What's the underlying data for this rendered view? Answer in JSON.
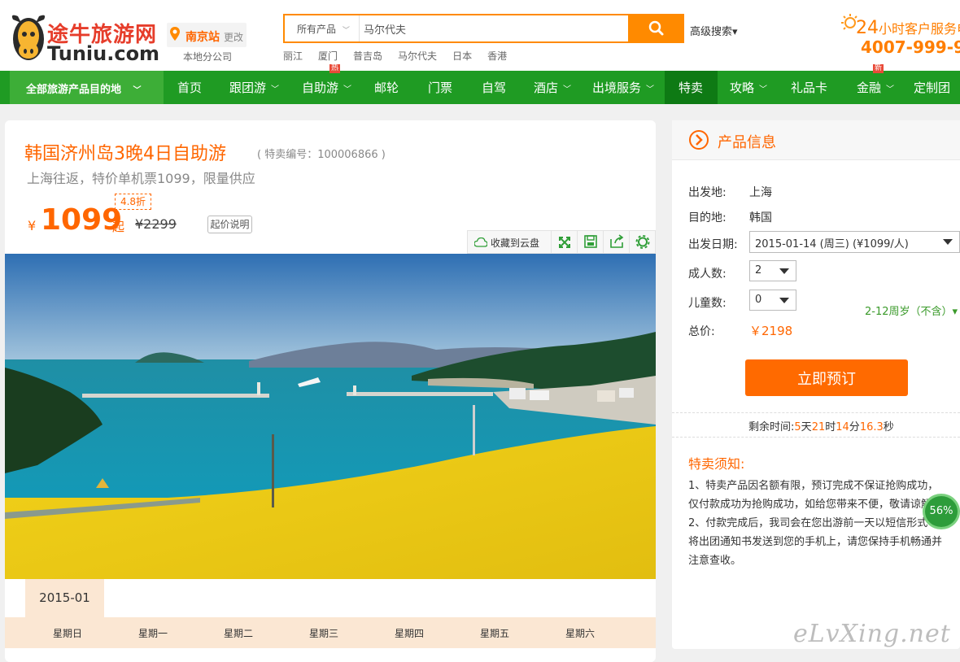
{
  "header": {
    "logo_cn": "途牛旅游网",
    "logo_en": "Tuniu.com",
    "city": "南京站",
    "city_change": "更改",
    "branch": "本地分公司",
    "search_category": "所有产品",
    "search_value": "马尔代夫",
    "advanced_search": "高级搜索▾",
    "hot_words": [
      "丽江",
      "厦门",
      "普吉岛",
      "马尔代夫",
      "日本",
      "香港"
    ],
    "hotline_label_a": "24",
    "hotline_label_b": "小时客户服务电",
    "hotline_number": "4007-999-9"
  },
  "nav": {
    "all": "全部旅游产品目的地",
    "items": [
      "首页",
      "跟团游",
      "自助游",
      "邮轮",
      "门票",
      "自驾",
      "酒店",
      "出境服务",
      "特卖",
      "攻略",
      "礼品卡",
      "金融",
      "定制团"
    ],
    "flag_hot": "热",
    "flag_new": "新"
  },
  "product": {
    "title": "韩国济州岛3晚4日自助游",
    "code": "( 特卖编号：100006866 )",
    "subtitle": "上海往返，特价单机票1099，限量供应",
    "discount": "4.8折",
    "currency": "¥",
    "price": "1099",
    "price_unit": "起",
    "old_price": "¥2299",
    "price_note": "起价说明",
    "cloud_save": "收藏到云盘"
  },
  "calendar": {
    "month": "2015-01",
    "weekdays": [
      "星期日",
      "星期一",
      "星期二",
      "星期三",
      "星期四",
      "星期五",
      "星期六"
    ]
  },
  "side": {
    "title": "产品信息",
    "depart_label": "出发地:",
    "depart": "上海",
    "dest_label": "目的地:",
    "dest": "韩国",
    "date_label": "出发日期:",
    "date": "2015-01-14 (周三) (¥1099/人)",
    "adults_label": "成人数:",
    "adults": "2",
    "children_label": "儿童数:",
    "children": "0",
    "age_note": "2-12周岁（不含）▾",
    "total_label": "总价:",
    "total": "￥2198",
    "book": "立即预订",
    "countdown": {
      "prefix": "剩余时间:",
      "days": "5",
      "days_u": "天",
      "hours": "21",
      "hours_u": "时",
      "mins": "14",
      "mins_u": "分",
      "secs": "16.3",
      "secs_u": "秒"
    },
    "notice_title": "特卖须知:",
    "notice_lines": [
      "1、特卖产品因名额有限，预订完成不保证抢购成功，",
      "仅付款成功为抢购成功，如给您带来不便，敬请谅解。",
      "2、付款完成后，我司会在您出游前一天以短信形式",
      "将出团通知书发送到您的手机上，请您保持手机畅通并",
      "注意查收。"
    ],
    "progress": "56%"
  },
  "watermark": "eLvXing.net",
  "colors": {
    "brand_orange": "#ff6600",
    "nav_green": "#1f9b23",
    "button_orange": "#ff6a00"
  }
}
